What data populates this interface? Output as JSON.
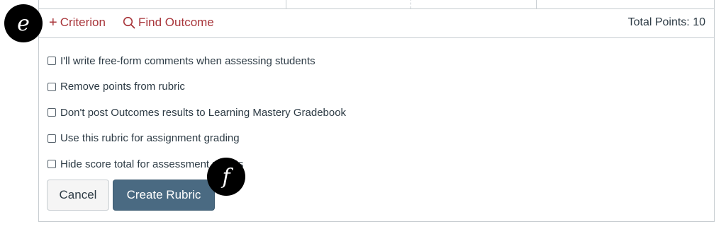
{
  "toolbar": {
    "add_criterion_label": "Criterion",
    "add_criterion_icon": "plus-icon",
    "find_outcome_label": "Find Outcome",
    "find_outcome_icon": "search-icon",
    "total_points": "Total Points: 10"
  },
  "options": [
    {
      "label": "I'll write free-form comments when assessing students",
      "checked": false
    },
    {
      "label": "Remove points from rubric",
      "checked": false
    },
    {
      "label": "Don't post Outcomes results to Learning Mastery Gradebook",
      "checked": false
    },
    {
      "label": "Use this rubric for assignment grading",
      "checked": false
    },
    {
      "label": "Hide score total for assessment results",
      "checked": false
    }
  ],
  "buttons": {
    "cancel": "Cancel",
    "create": "Create Rubric"
  },
  "markers": {
    "e": "e",
    "f": "f"
  },
  "colors": {
    "link": "#a8353a",
    "primary_button": "#4a6a82",
    "text": "#2d3b45"
  }
}
